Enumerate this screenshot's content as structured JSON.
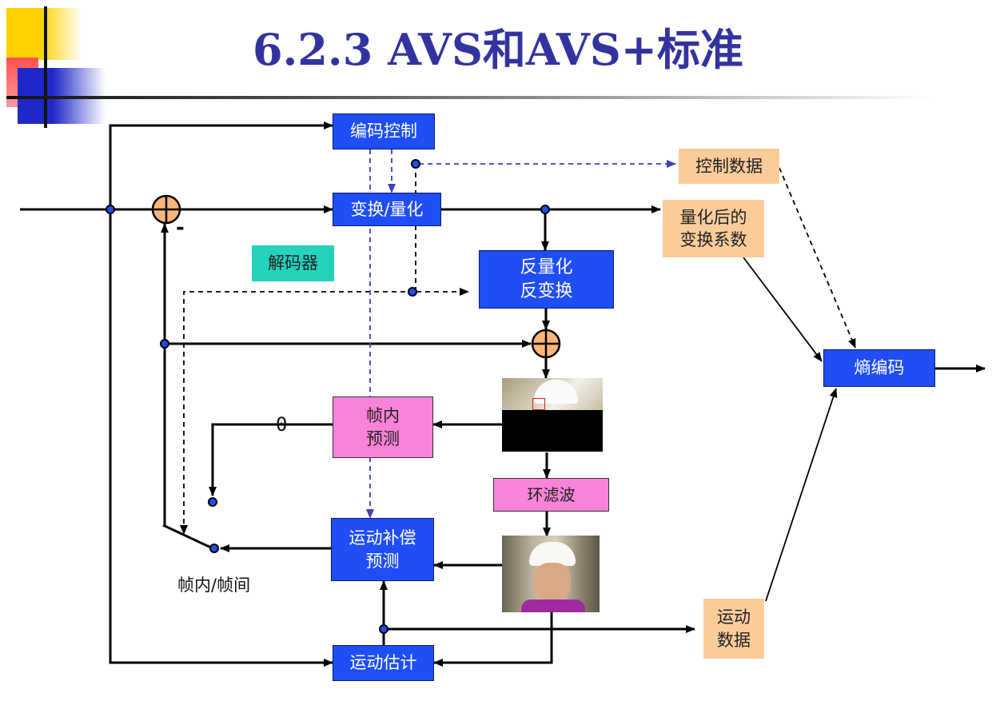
{
  "title": "6.2.3  AVS和AVS+标准",
  "blocks": {
    "coding_control": "编码控制",
    "transform_quant": "变换/量化",
    "inverse": "反量化\n反变换",
    "intra_pred": "帧内\n预测",
    "loop_filter": "环滤波",
    "mc_pred": "运动补偿\n预测",
    "motion_est": "运动估计",
    "entropy": "熵编码",
    "control_data": "控制数据",
    "quant_coeff": "量化后的\n变换系数",
    "motion_data": "运动\n数据",
    "decoder": "解码器"
  },
  "labels": {
    "minus": "-",
    "zero": "0",
    "intra_inter": "帧内/帧间"
  },
  "colors": {
    "block_blue": "#1f4ef6",
    "block_pink": "#f983d8",
    "block_peach": "#f9cc9a",
    "decoder_teal": "#25d2bc",
    "title": "#3333a0",
    "dashed_blue": "#4040c0"
  }
}
